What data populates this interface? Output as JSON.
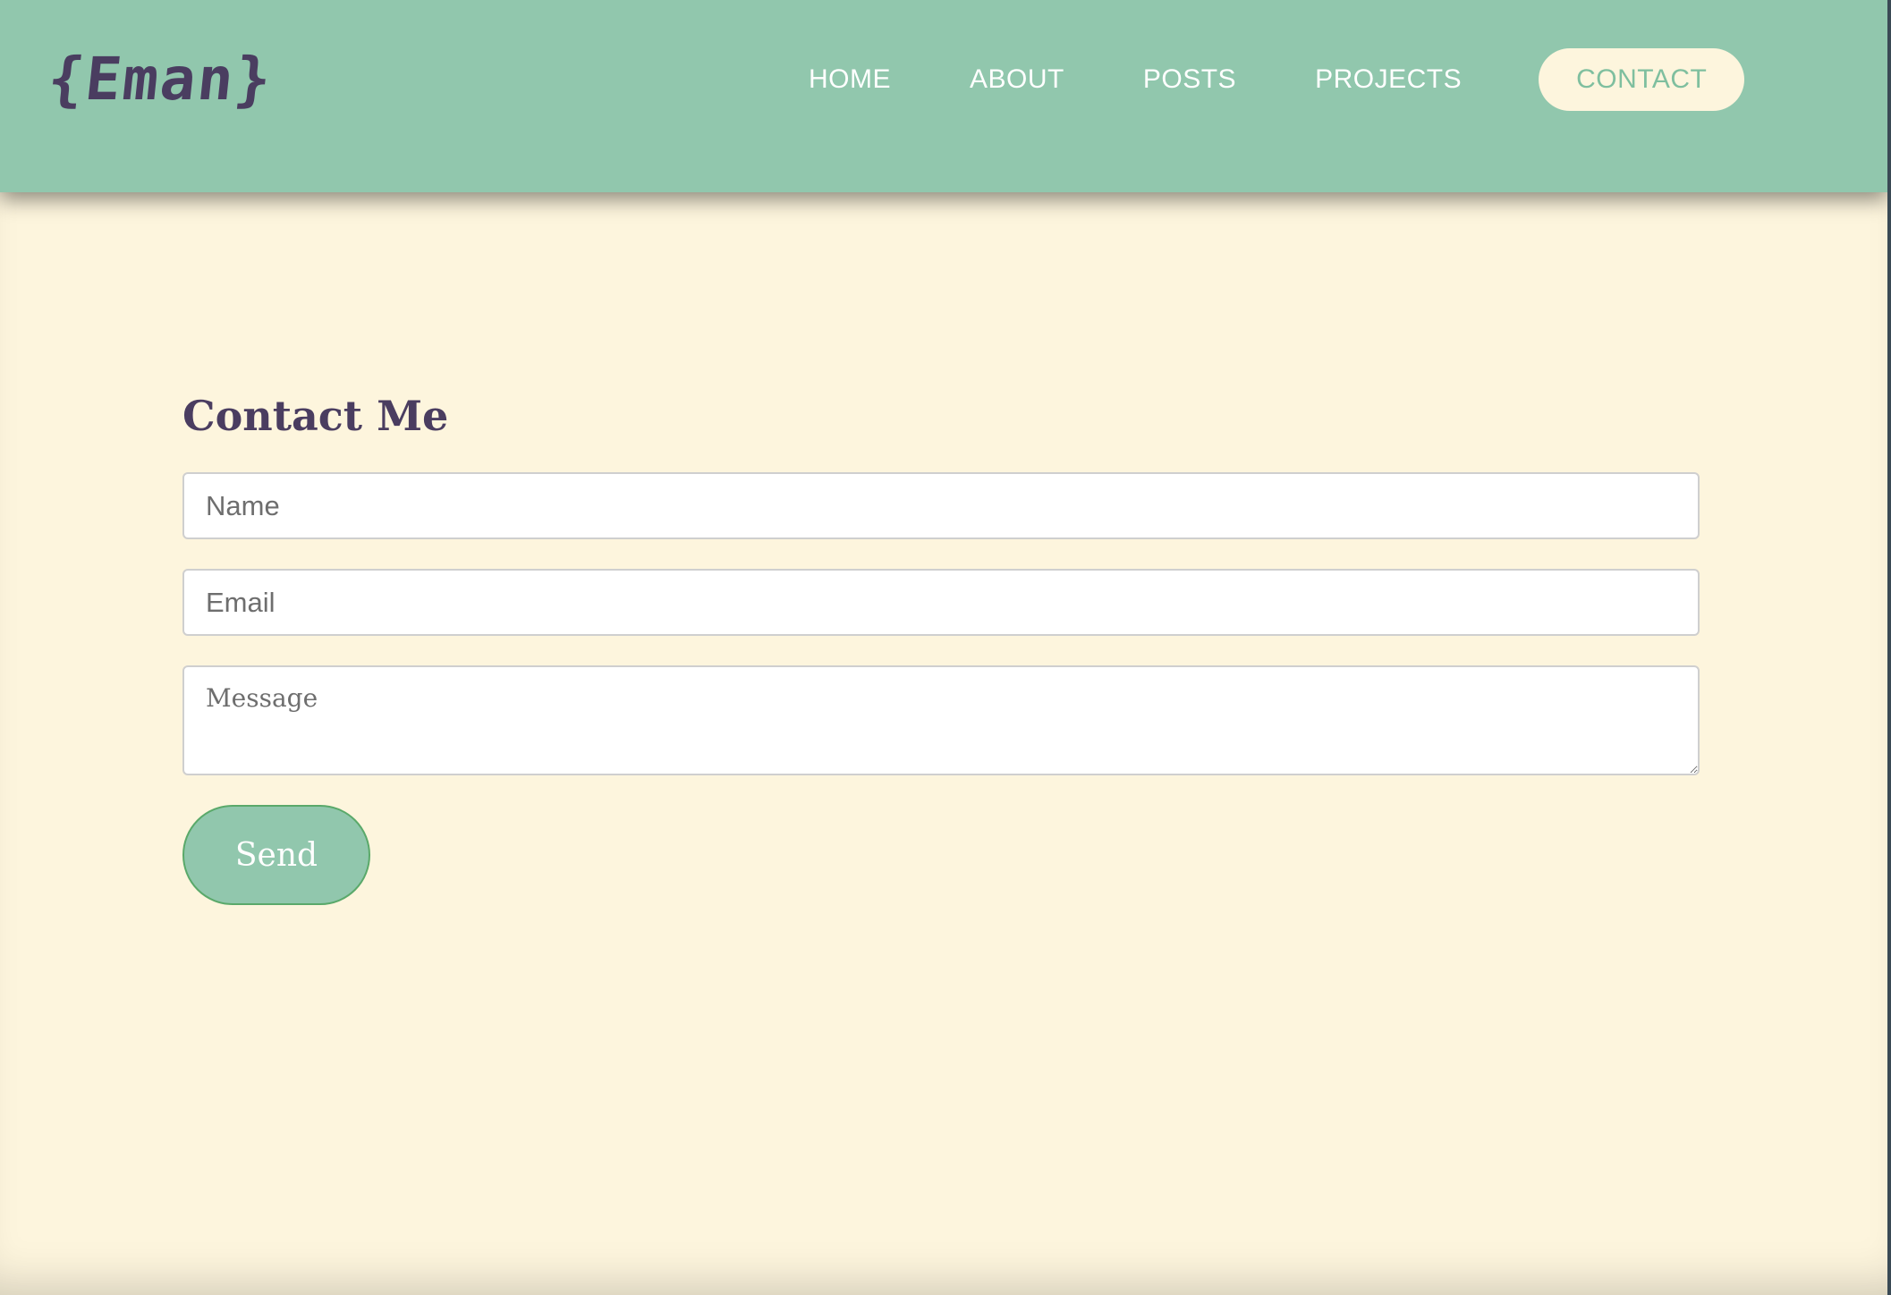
{
  "brand": {
    "logo_text": "{Eman}"
  },
  "nav": {
    "items": [
      {
        "label": "HOME",
        "active": false
      },
      {
        "label": "ABOUT",
        "active": false
      },
      {
        "label": "POSTS",
        "active": false
      },
      {
        "label": "PROJECTS",
        "active": false
      },
      {
        "label": "CONTACT",
        "active": true
      }
    ]
  },
  "contact_form": {
    "title": "Contact Me",
    "name": {
      "value": "",
      "placeholder": "Name"
    },
    "email": {
      "value": "",
      "placeholder": "Email"
    },
    "message": {
      "value": "",
      "placeholder": "Message"
    },
    "send_label": "Send"
  },
  "colors": {
    "header_bg": "#91c7ad",
    "page_bg": "#fdf5dd",
    "heading_text": "#4a3d60",
    "button_border": "#5aa96a",
    "active_nav_text": "#7fbf9f"
  }
}
